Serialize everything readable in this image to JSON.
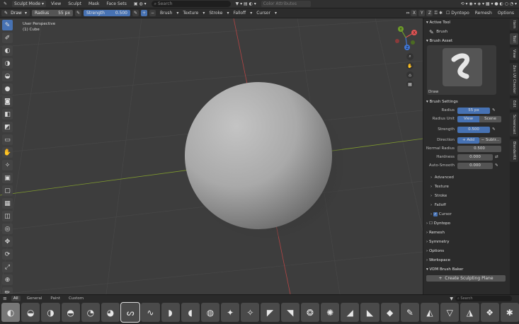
{
  "header": {
    "mode": "Sculpt Mode",
    "menus": [
      "View",
      "Sculpt",
      "Mask",
      "Face Sets"
    ],
    "search_placeholder": "Search",
    "color_attributes": "Color Attributes"
  },
  "toolbar": {
    "brush": "Draw",
    "radius_label": "Radius",
    "radius_value": "55 px",
    "strength_label": "Strength",
    "strength_value": "0.500",
    "menus": [
      "Brush",
      "Texture",
      "Stroke",
      "Falloff",
      "Cursor"
    ],
    "axes": [
      "X",
      "Y",
      "Z"
    ],
    "dyntopo": "Dyntopo",
    "remesh": "Remesh",
    "options": "Options"
  },
  "viewport": {
    "perspective": "User Perspective",
    "object": "(1) Cube",
    "gizmo": {
      "x": "X",
      "y": "Y",
      "z": "Z"
    }
  },
  "panel": {
    "active_tool_header": "Active Tool",
    "active_tool": "Brush",
    "brush_asset_header": "Brush Asset",
    "brush_name": "Draw",
    "brush_settings_header": "Brush Settings",
    "radius_label": "Radius",
    "radius_value": "55 px",
    "radius_unit_label": "Radius Unit",
    "radius_unit_view": "View",
    "radius_unit_scene": "Scene",
    "strength_label": "Strength",
    "strength_value": "0.500",
    "direction_label": "Direction",
    "direction_add": "Add",
    "direction_sub": "Subtr...",
    "normal_radius_label": "Normal Radius",
    "normal_radius_value": "0.500",
    "hardness_label": "Hardness",
    "hardness_value": "0.000",
    "auto_smooth_label": "Auto-Smooth",
    "auto_smooth_value": "0.000",
    "subsections": [
      "Advanced",
      "Texture",
      "Stroke",
      "Falloff"
    ],
    "cursor_label": "Cursor",
    "sections": [
      "Dyntopo",
      "Remesh",
      "Symmetry",
      "Options",
      "Workspace",
      "VDM Brush Baker"
    ],
    "create_plane": "Create Sculpting Plane"
  },
  "ntabs": [
    "Item",
    "Tool",
    "View",
    "Zen UV Checker",
    "Edit",
    "Screencast",
    "BlenderKit"
  ],
  "shelf": {
    "tabs": [
      "All",
      "General",
      "Paint",
      "Custom"
    ],
    "search_placeholder": "Search",
    "brush_count": 26
  }
}
